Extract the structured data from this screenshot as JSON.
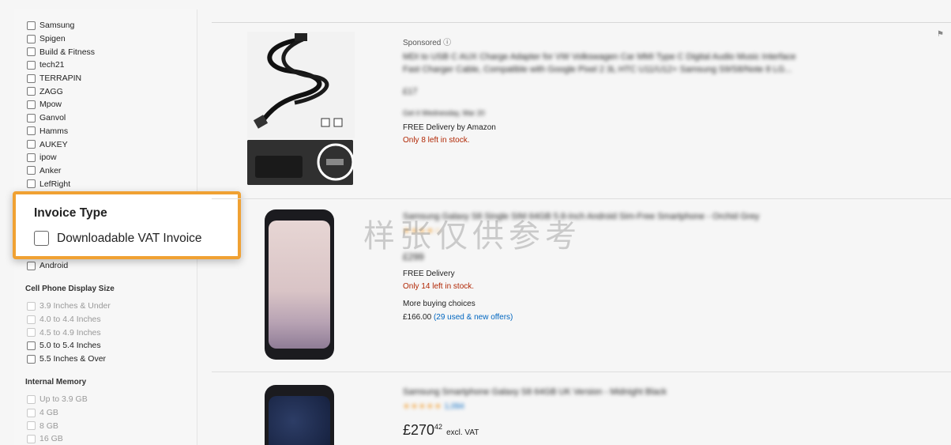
{
  "sidebar": {
    "brands": [
      "Samsung",
      "Spigen",
      "Build & Fitness",
      "tech21",
      "TERRAPIN",
      "ZAGG",
      "Mpow",
      "Ganvol",
      "Hamms",
      "AUKEY",
      "ipow",
      "Anker",
      "LefRight"
    ],
    "os_option": "Android",
    "display_size": {
      "title": "Cell Phone Display Size",
      "options": [
        "3.9 Inches & Under",
        "4.0 to 4.4 Inches",
        "4.5 to 4.9 Inches",
        "5.0 to 5.4 Inches",
        "5.5 Inches & Over"
      ]
    },
    "memory": {
      "title": "Internal Memory",
      "options": [
        "Up to 3.9 GB",
        "4 GB",
        "8 GB",
        "16 GB"
      ]
    }
  },
  "invoice_popup": {
    "title": "Invoice Type",
    "option": "Downloadable VAT Invoice",
    "highlight_color": "#f0a133"
  },
  "results": {
    "items": [
      {
        "sponsored": "Sponsored ⓘ",
        "title_line1": "MDI to USB C AUX Charge Adapter for VW Volkswagen Car MMI Type C Digital Audio Music Interface",
        "title_line2": "Fast Charger Cable, Compatible with Google Pixel 2 3L HTC U11/U12+ Samsung S9/S8/Note 8 LG...",
        "price": "£17",
        "delivery_date": "Get it Wednesday, Mar 20",
        "delivery": "FREE Delivery by Amazon",
        "stock": "Only 8 left in stock."
      },
      {
        "title": "Samsung Galaxy S8 Single SIM 64GB 5.8-Inch Android Sim-Free Smartphone - Orchid Grey",
        "price": "£299",
        "delivery": "FREE Delivery",
        "stock": "Only 14 left in stock.",
        "more": "More buying choices",
        "offer_price": "£166.00",
        "offers": "(29 used & new offers)"
      },
      {
        "title": "Samsung Smartphone Galaxy S8 64GB UK Version - Midnight Black",
        "rating_count": "1,094",
        "price_main": "£270",
        "price_frac": "42",
        "price_note": "excl. VAT"
      }
    ]
  },
  "watermark": "样张仅供参考"
}
